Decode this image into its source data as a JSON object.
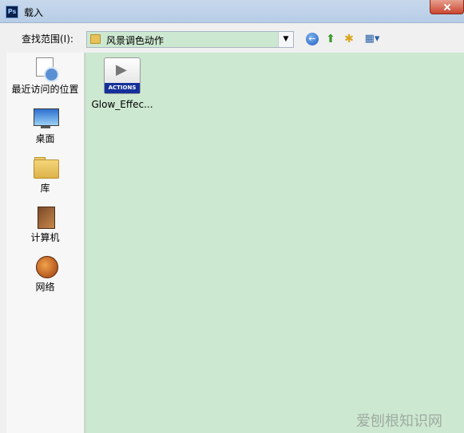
{
  "window": {
    "title": "载入",
    "app_badge": "Ps"
  },
  "toolbar": {
    "lookin_label": "查找范围(I):",
    "lookin_value": "风景调色动作"
  },
  "places": [
    {
      "label": "最近访问的位置",
      "icon": "recent-places-icon"
    },
    {
      "label": "桌面",
      "icon": "desktop-icon"
    },
    {
      "label": "库",
      "icon": "library-icon"
    },
    {
      "label": "计算机",
      "icon": "computer-icon"
    },
    {
      "label": "网络",
      "icon": "network-icon"
    }
  ],
  "files": [
    {
      "name": "Glow_Effec...",
      "icon_text": "ACTIONS",
      "icon": "actions-file-icon"
    }
  ],
  "watermark": "爱刨根知识网",
  "colors": {
    "file_area_bg": "#cde8d1",
    "title_bar": "#b7cde6",
    "close_button": "#c9462f"
  }
}
